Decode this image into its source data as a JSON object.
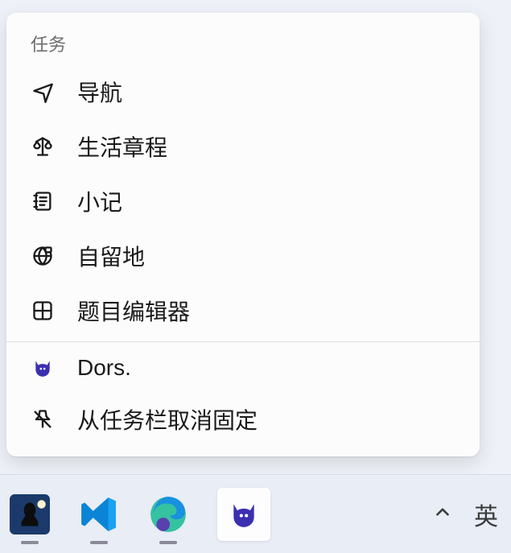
{
  "jumplist": {
    "section_header": "任务",
    "tasks": [
      {
        "label": "导航"
      },
      {
        "label": "生活章程"
      },
      {
        "label": "小记"
      },
      {
        "label": "自留地"
      },
      {
        "label": "题目编辑器"
      }
    ],
    "app_item": {
      "label": "Dors."
    },
    "unpin_item": {
      "label": "从任务栏取消固定"
    }
  },
  "taskbar": {
    "ime_indicator": "英"
  }
}
